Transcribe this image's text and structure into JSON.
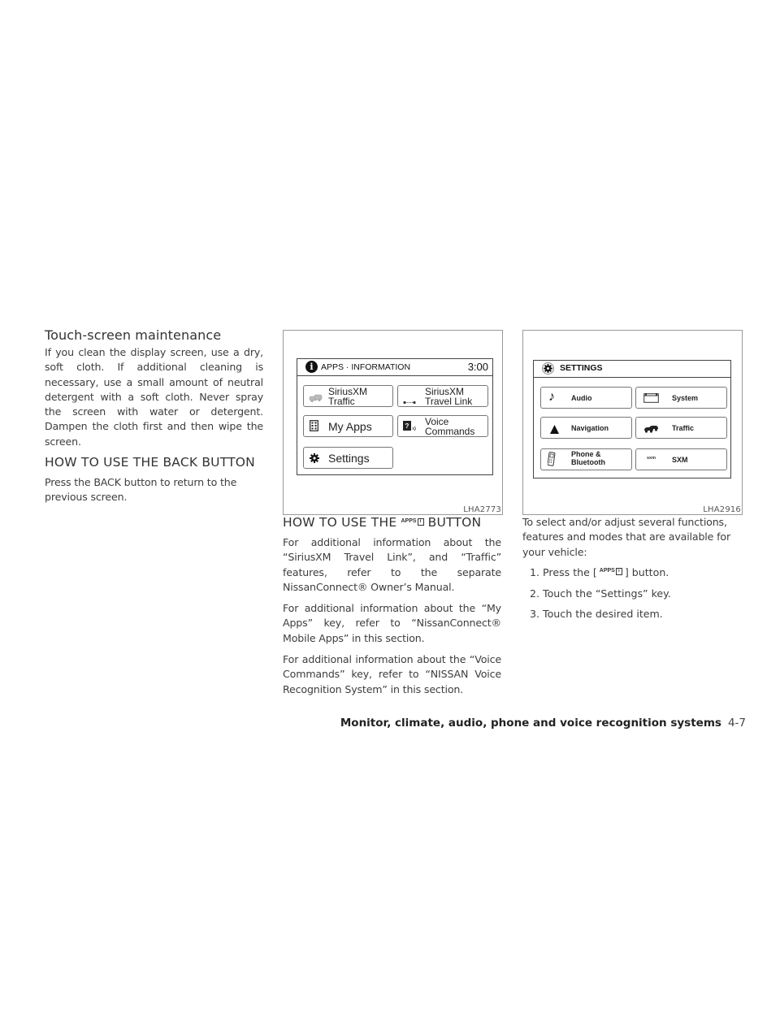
{
  "left_column": {
    "heading": "Touch-screen maintenance",
    "paragraph": "If you clean the display screen, use a dry, soft cloth. If additional cleaning is necessary, use a small amount of neutral detergent with a soft cloth. Never spray the screen with water or detergent. Dampen the cloth first and then wipe the screen.",
    "section_heading": "HOW TO USE THE BACK BUTTON",
    "section_paragraph": "Press the BACK button to return to the previous screen."
  },
  "figure_apps": {
    "code": "LHA2773",
    "screen_title": "APPS · INFORMATION",
    "time": "3:00",
    "buttons": [
      {
        "line1": "SiriusXM",
        "line2": "Traffic",
        "icon": "traffic-cars-icon"
      },
      {
        "line1": "SiriusXM",
        "line2": "Travel Link",
        "icon": "travel-link-icon"
      },
      {
        "line1": "My Apps",
        "line2": "",
        "icon": "apps-grid-icon"
      },
      {
        "line1": "Voice",
        "line2": "Commands",
        "icon": "voice-commands-icon"
      },
      {
        "line1": "Settings",
        "line2": "",
        "icon": "gear-icon"
      }
    ]
  },
  "middle_column": {
    "heading_before": "HOW TO USE THE",
    "heading_glyph": "APPS",
    "heading_glyph_box": "i",
    "heading_after": "BUTTON",
    "paragraphs": [
      "For additional information about the “SiriusXM Travel Link”, and “Traffic” features, refer to the separate NissanConnect® Owner’s Manual.",
      "For additional information about the “My Apps” key, refer to “NissanConnect® Mobile Apps” in this section.",
      "For additional information about the “Voice Commands” key, refer to “NISSAN Voice Recognition System” in this section."
    ]
  },
  "figure_settings": {
    "code": "LHA2916",
    "screen_title": "SETTINGS",
    "buttons": [
      {
        "line1": "Audio",
        "line2": "",
        "icon": "music-note-icon"
      },
      {
        "line1": "System",
        "line2": "",
        "icon": "system-screen-icon"
      },
      {
        "line1": "Navigation",
        "line2": "",
        "icon": "navigation-arrow-icon"
      },
      {
        "line1": "Traffic",
        "line2": "",
        "icon": "traffic-cars-icon"
      },
      {
        "line1": "Phone &",
        "line2": "Bluetooth",
        "icon": "phone-icon"
      },
      {
        "line1": "SXM",
        "line2": "",
        "icon": "sxm-icon",
        "icon_text": "sxm"
      }
    ]
  },
  "right_column": {
    "intro": "To select and/or adjust several functions, features and modes that are available for your vehicle:",
    "steps": [
      {
        "num": "1.",
        "before": "Press the [",
        "glyph": "APPS",
        "glyph_box": "i",
        "after": "] button."
      },
      {
        "num": "2.",
        "text": "Touch the “Settings” key."
      },
      {
        "num": "3.",
        "text": "Touch the desired item."
      }
    ]
  },
  "footer": {
    "section": "Monitor, climate, audio, phone and voice recognition systems",
    "page": "4-7"
  }
}
